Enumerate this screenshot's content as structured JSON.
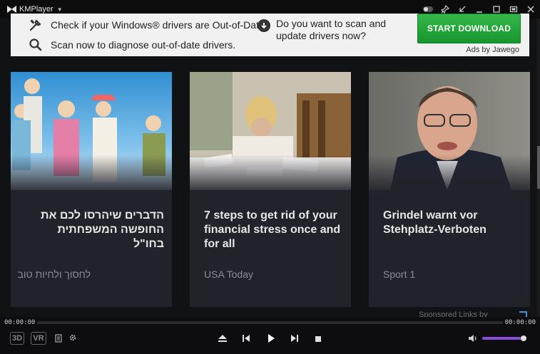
{
  "app": {
    "title": "KMPlayer"
  },
  "ad": {
    "line1": "Check if your Windows® drivers are Out-of-Date.",
    "line2": "Scan now to diagnose out-of-date drivers.",
    "question": "Do you want to scan and update drivers now?",
    "button": "START DOWNLOAD",
    "ads_by": "Ads by Jawego"
  },
  "cards": [
    {
      "title": "הדברים שיהרסו לכם את החופשה המשפחתית בחו\"ל",
      "source": "לחסוך ולחיות טוב"
    },
    {
      "title": "7 steps to get rid of your financial stress once and for all",
      "source": "USA Today"
    },
    {
      "title": "Grindel warnt vor Stehplatz-Verboten",
      "source": "Sport 1"
    }
  ],
  "sponsored": "Sponsored Links by Taboola",
  "player": {
    "time_elapsed": "00:00:00",
    "time_total": "00:00:00",
    "progress": 0,
    "volume": 0.9,
    "badge_3d": "3D",
    "badge_vr": "VR"
  },
  "colors": {
    "accent": "#8a4fd8",
    "download": "#1fa536",
    "card_bg": "#22222a"
  }
}
